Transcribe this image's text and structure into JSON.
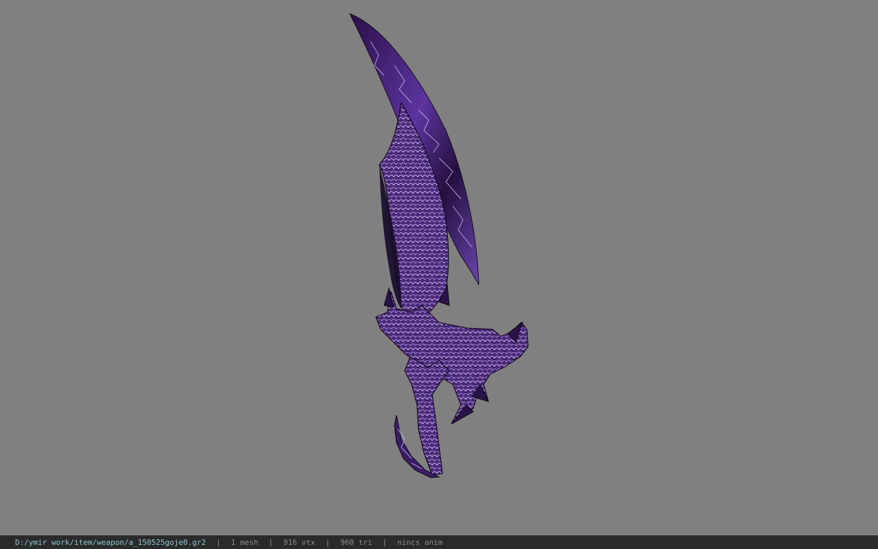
{
  "viewport": {
    "background_color": "#808080",
    "model": {
      "icon": "purple-dragon-sword-model",
      "primary_color": "#3b1f63",
      "highlight_color": "#b59be0",
      "dark_color": "#0e0718"
    }
  },
  "status_bar": {
    "file_path": "D:/ymir work/item/weapon/a_150525goje0.gr2",
    "separator": "|",
    "mesh_count": "1 mesh",
    "vertex_count": "916 vtx",
    "triangle_count": "960 tri",
    "anim_status": "nincs anim",
    "path_color": "#8fc6d6",
    "text_color": "#8c8c8c"
  }
}
